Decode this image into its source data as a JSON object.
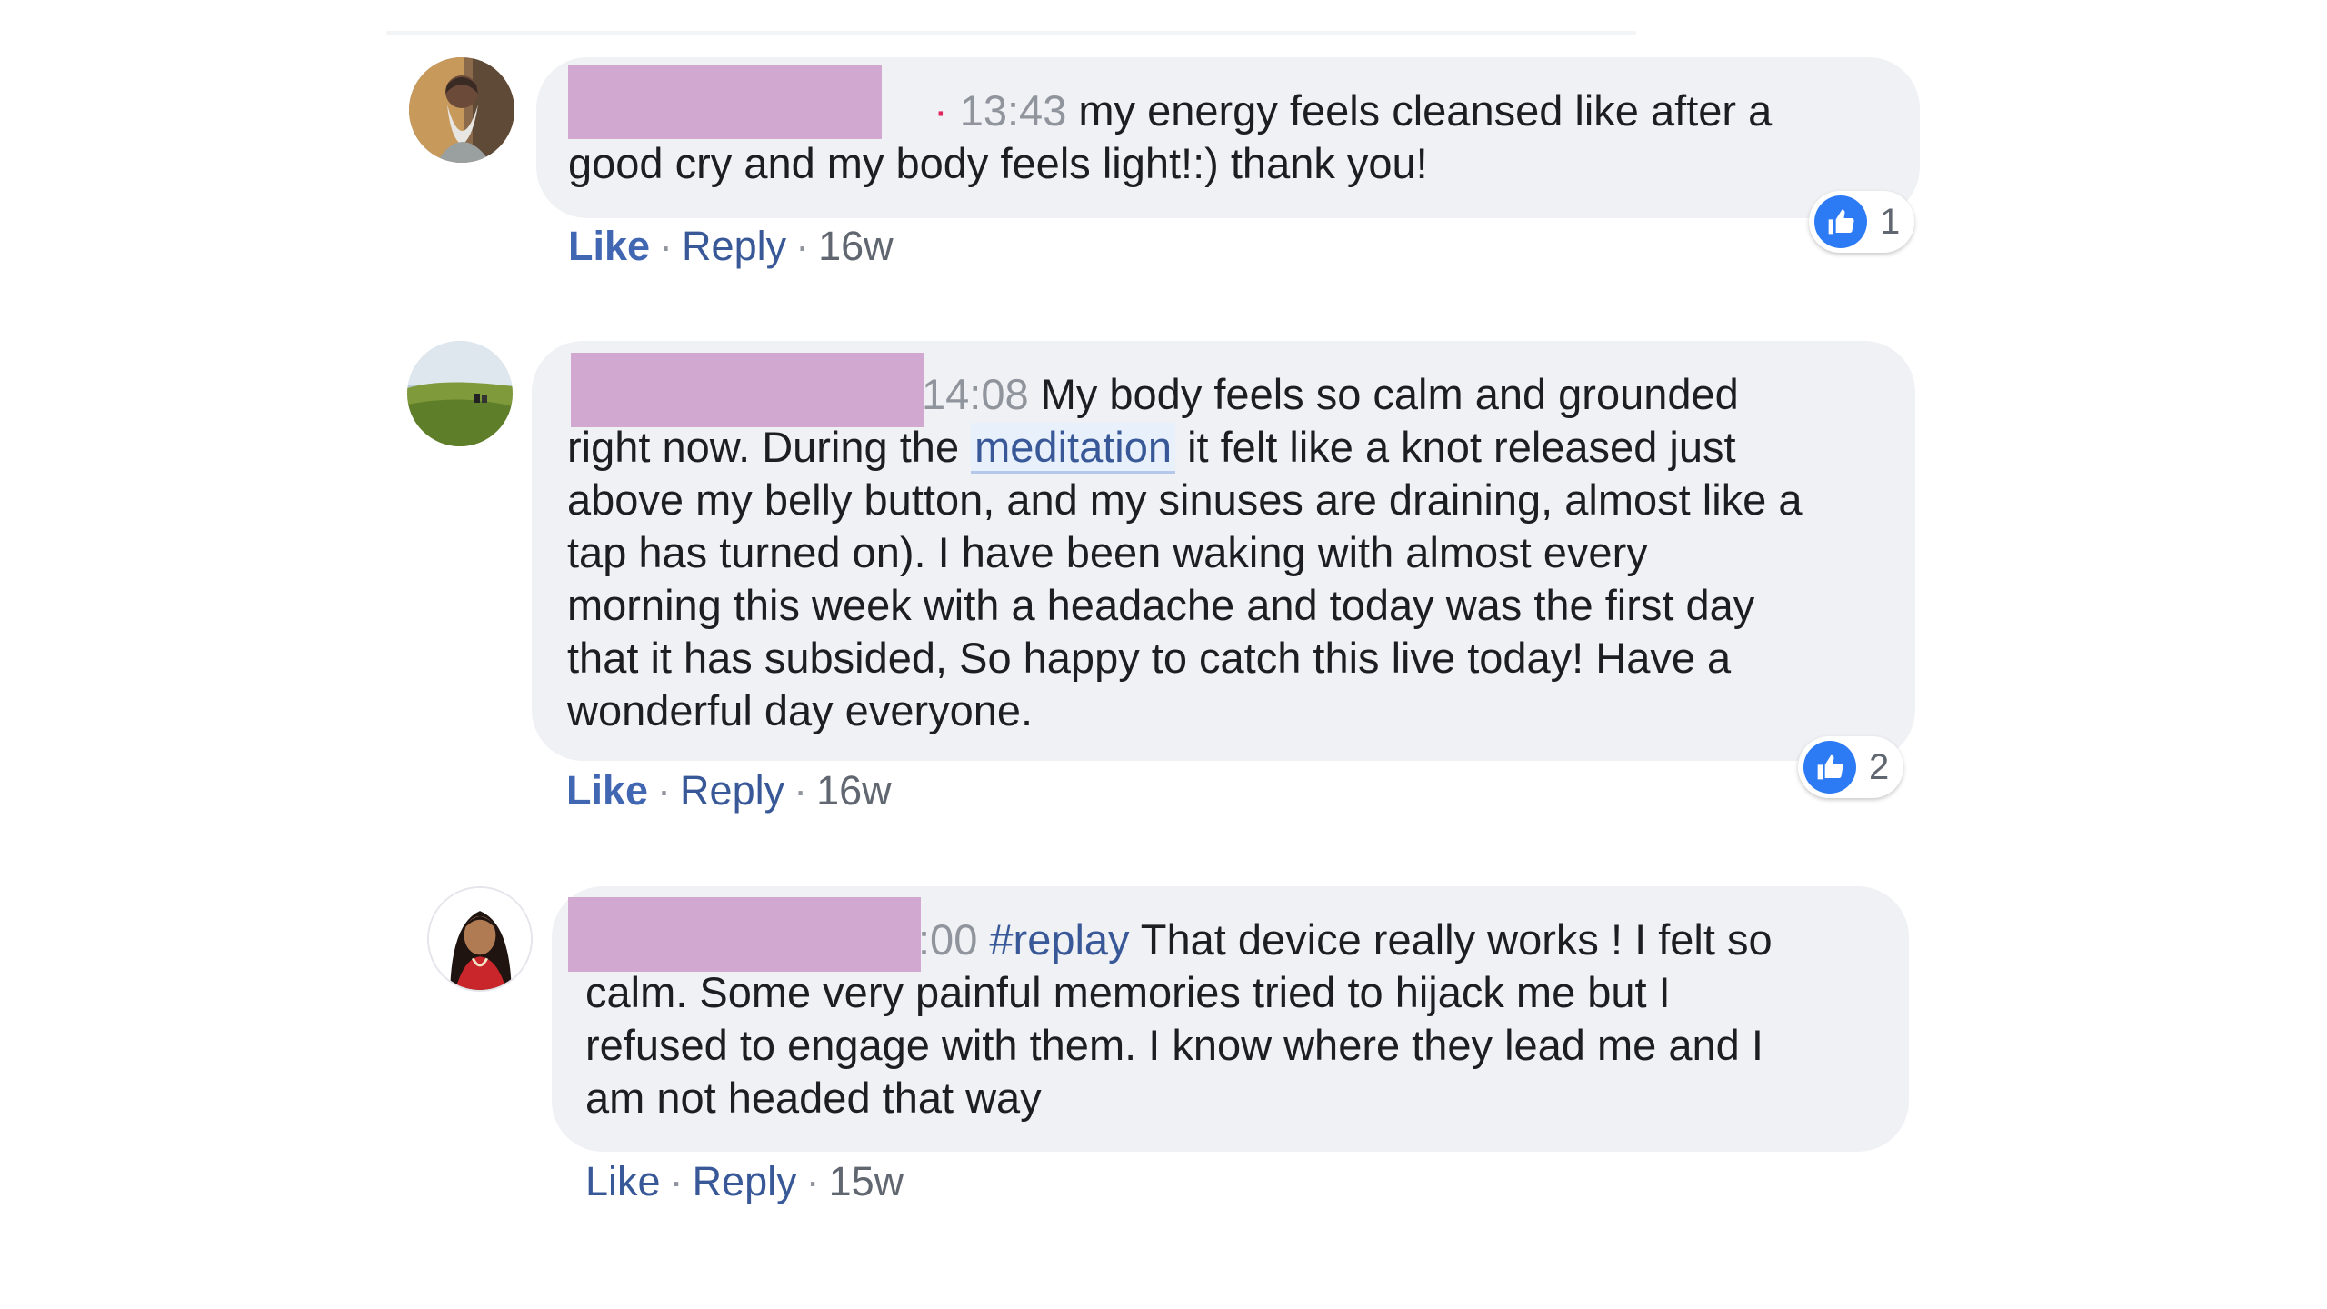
{
  "comments": [
    {
      "timestamp": "13:43",
      "lines": [
        "my energy feels cleansed like after a",
        "good cry and my body feels light!:) thank you!"
      ],
      "actions": {
        "like": "Like",
        "reply": "Reply",
        "time": "16w"
      },
      "reaction_count": "1"
    },
    {
      "timestamp": "14:08",
      "line1_text": "My body feels so calm and grounded",
      "line2_pre": "right now. During the",
      "line2_link": "meditation",
      "line2_post": "it felt like a knot released just",
      "lines": [
        "above my belly button, and my sinuses are draining, almost like a",
        "tap has turned on). I have been waking with almost every",
        "morning this week with a headache and today was the first day",
        "that it has subsided, So happy to catch this live today! Have a",
        "wonderful day everyone."
      ],
      "actions": {
        "like": "Like",
        "reply": "Reply",
        "time": "16w"
      },
      "reaction_count": "2"
    },
    {
      "timestamp": ":00",
      "hashtag": "#replay",
      "line1_text": "That device really works ! I felt so",
      "lines": [
        "calm. Some very painful memories tried to hijack me but I",
        "refused to engage with them. I know where they lead me and I",
        "am not headed that way"
      ],
      "actions": {
        "like": "Like",
        "reply": "Reply",
        "time": "15w"
      }
    }
  ],
  "colors": {
    "bubble": "#f0f1f4",
    "redaction": "#d0a8d0",
    "link": "#385898",
    "like_blue": "#2d7bf4",
    "timestamp": "#90949c"
  },
  "icons": {
    "reaction": "thumbs-up-icon"
  }
}
